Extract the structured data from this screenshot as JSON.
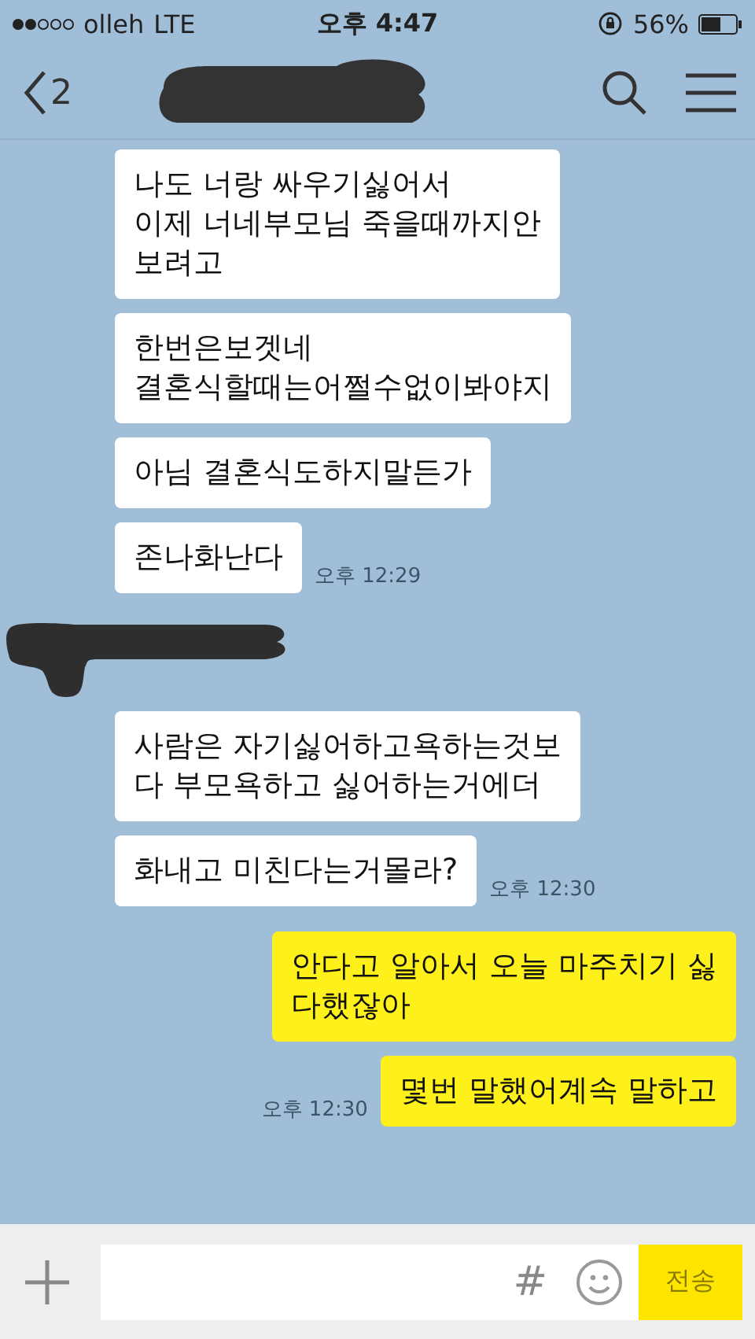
{
  "status_bar": {
    "carrier": "olleh",
    "network": "LTE",
    "time": "오후 4:47",
    "battery": "56%"
  },
  "header": {
    "unread_count": "2"
  },
  "groups": [
    {
      "kind": "received",
      "name_redacted": false,
      "messages": [
        {
          "text": "나도 너랑 싸우기싫어서\n이제 너네부모님 죽을때까지안\n보려고"
        },
        {
          "text": "한번은보겟네\n결혼식할때는어쩔수없이봐야지"
        },
        {
          "text": "아님 결혼식도하지말든가"
        },
        {
          "text": "존나화난다",
          "time": "오후 12:29"
        }
      ]
    },
    {
      "kind": "received",
      "name_redacted": true,
      "messages": [
        {
          "text": "사람은 자기싫어하고욕하는것보\n다 부모욕하고 싫어하는거에더"
        },
        {
          "text": "화내고 미친다는거몰라?",
          "time": "오후 12:30"
        }
      ]
    },
    {
      "kind": "sent",
      "name_redacted": false,
      "messages": [
        {
          "text": "안다고 알아서 오늘 마주치기 싫\n다했잖아"
        },
        {
          "text": "몇번 말했어계속 말하고",
          "time": "오후 12:30"
        }
      ]
    }
  ],
  "input": {
    "hash": "#",
    "send": "전송"
  }
}
